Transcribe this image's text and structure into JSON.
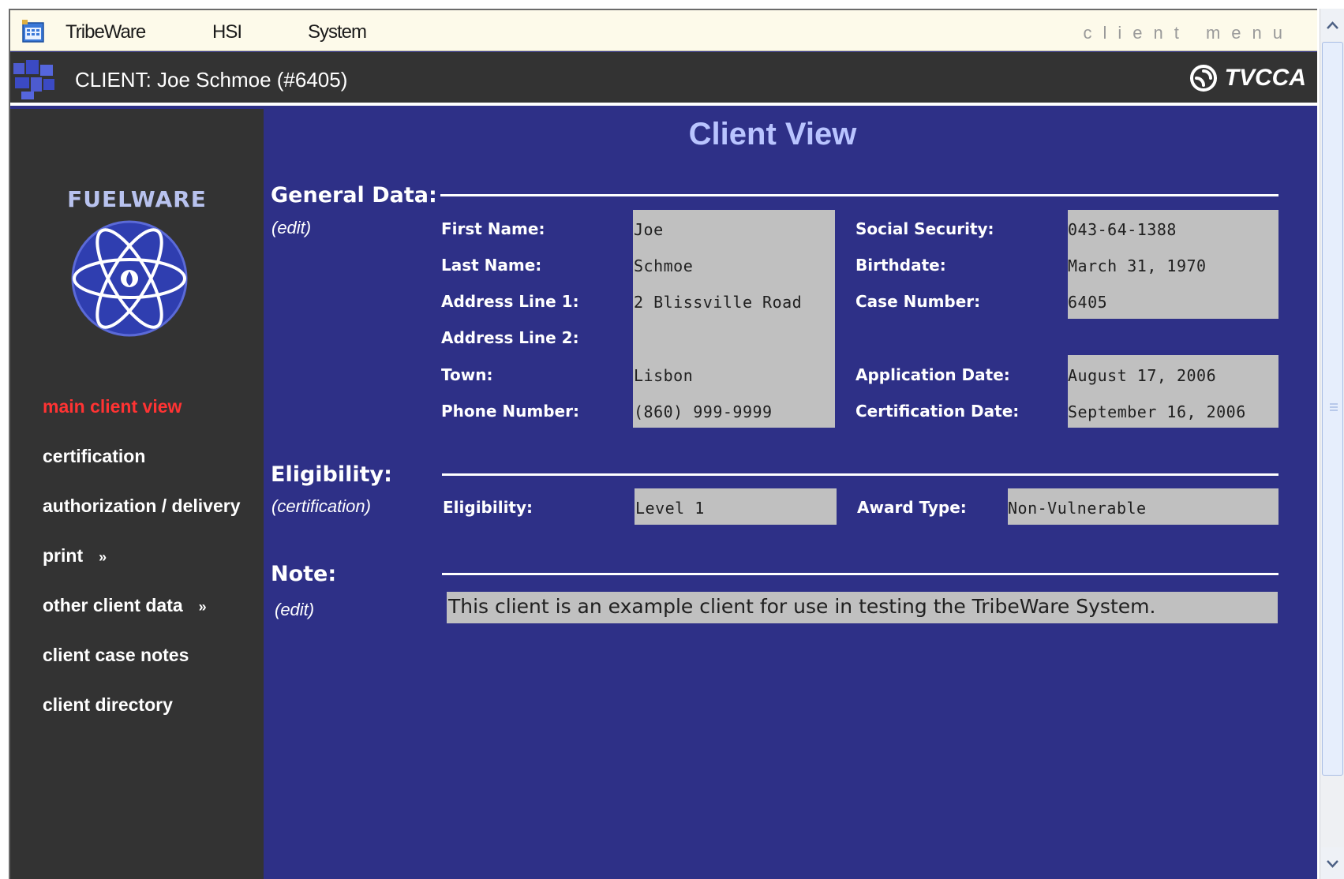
{
  "menubar": {
    "items": [
      "TribeWare",
      "HSI",
      "System"
    ],
    "client_menu": "client menu"
  },
  "client_header": {
    "title": "CLIENT: Joe Schmoe (#6405)",
    "org_name": "TVCCA"
  },
  "sidebar": {
    "brand": "FUELWARE",
    "nav": [
      {
        "label": "main client view",
        "active": true
      },
      {
        "label": "certification"
      },
      {
        "label": "authorization / delivery"
      },
      {
        "label": "print",
        "arrow": "»"
      },
      {
        "label": "other client data",
        "arrow": "»"
      },
      {
        "label": "client case notes"
      },
      {
        "label": "client directory"
      }
    ]
  },
  "main": {
    "page_title": "Client View",
    "general": {
      "title": "General Data:",
      "link": "(edit)",
      "first_name_label": "First Name:",
      "first_name": "Joe",
      "last_name_label": "Last Name:",
      "last_name": "Schmoe",
      "address1_label": "Address Line 1:",
      "address1": "2 Blissville Road",
      "address2_label": "Address Line 2:",
      "address2": "",
      "town_label": "Town:",
      "town": "Lisbon",
      "phone_label": "Phone Number:",
      "phone": "(860) 999-9999",
      "ssn_label": "Social Security:",
      "ssn": "043-64-1388",
      "birthdate_label": "Birthdate:",
      "birthdate": "March 31, 1970",
      "case_number_label": "Case Number:",
      "case_number": "6405",
      "application_date_label": "Application Date:",
      "application_date": "August 17, 2006",
      "certification_date_label": "Certification Date:",
      "certification_date": "September 16, 2006"
    },
    "eligibility": {
      "title": "Eligibility:",
      "link": "(certification)",
      "eligibility_label": "Eligibility:",
      "eligibility": "Level 1",
      "award_type_label": "Award Type:",
      "award_type": "Non-Vulnerable"
    },
    "note": {
      "title": "Note:",
      "link": "(edit)",
      "text": "This client is an example client for use in testing the TribeWare System."
    }
  },
  "colors": {
    "content_bg": "#2e3087",
    "sidebar_bg": "#333333",
    "active_nav": "#ff3333",
    "title_color": "#b9c4ff",
    "field_bg": "#c0c0c0"
  },
  "icons": [
    "calendar-icon",
    "client-logo-icon",
    "tvcca-logo-icon",
    "fuelware-atom-icon",
    "scroll-up-icon",
    "scroll-down-icon"
  ]
}
